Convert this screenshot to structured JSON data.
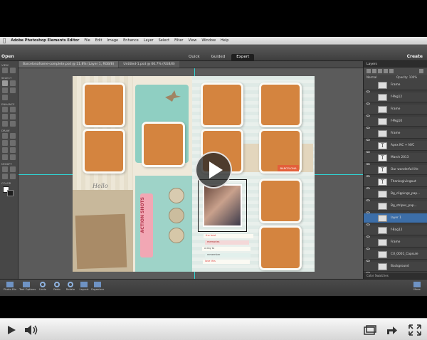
{
  "menubar": {
    "items": [
      "Adobe Photoshop Elements Editor",
      "File",
      "Edit",
      "Image",
      "Enhance",
      "Layer",
      "Select",
      "Filter",
      "View",
      "Window",
      "Help"
    ]
  },
  "topbar": {
    "open_label": "Open",
    "modes": [
      "Quick",
      "Guided",
      "Expert"
    ],
    "active_mode": "Expert",
    "create_label": "Create"
  },
  "doc_tabs": [
    "Barcelonaframe-complete.psd @ 11.8% (Layer 1, RGB/8)",
    "Untitled-1.psd @ 66.7% (RGB/8)"
  ],
  "tools_sections": [
    "VIEW",
    "SELECT",
    "ENHANCE",
    "DRAW",
    "MODIFY",
    "COLOR"
  ],
  "canvas": {
    "sticker_title": "ACTION SHOTS",
    "tag_text": "BARCELONA",
    "hello_text": "Hello",
    "notes": [
      "the best",
      "memories",
      "a day to",
      "remember",
      "love this"
    ]
  },
  "layers_panel": {
    "title": "Layers",
    "blend_mode": "Normal",
    "opacity_label": "Opacity: 100%",
    "layers": [
      {
        "name": "Frame",
        "type": "image",
        "selected": false
      },
      {
        "name": "f-Pkg12",
        "type": "image",
        "selected": false
      },
      {
        "name": "Frame",
        "type": "image",
        "selected": false
      },
      {
        "name": "f-Pkg10",
        "type": "image",
        "selected": false
      },
      {
        "name": "Frame",
        "type": "image",
        "selected": false
      },
      {
        "name": "Apex NC + NYC",
        "type": "text",
        "selected": false
      },
      {
        "name": "March 2013",
        "type": "text",
        "selected": false
      },
      {
        "name": "Our wonderful life",
        "type": "text",
        "selected": false
      },
      {
        "name": "Thanksgivingout",
        "type": "text",
        "selected": false
      },
      {
        "name": "Bg_clippings_pap...",
        "type": "image",
        "selected": false
      },
      {
        "name": "Bg_stripes_pap...",
        "type": "image",
        "selected": false
      },
      {
        "name": "layer 1",
        "type": "image",
        "selected": true
      },
      {
        "name": "f-Bag12",
        "type": "image",
        "selected": false
      },
      {
        "name": "Frame",
        "type": "image",
        "selected": false
      },
      {
        "name": "CU_0001_Capsule",
        "type": "image",
        "selected": false
      },
      {
        "name": "Background",
        "type": "image",
        "selected": false
      }
    ],
    "footer": "Color Swatches"
  },
  "bin": {
    "left_buttons": [
      "Photo Bin",
      "Tool Options",
      "Undo",
      "Redo",
      "Rotate",
      "Layout",
      "Organizer"
    ],
    "right_button": "More"
  },
  "player": {
    "progress": 0.02
  },
  "colors": {
    "photo_slot": "#d4843f",
    "guide": "#2fd6d6",
    "selected_layer": "#3c6ea8"
  }
}
